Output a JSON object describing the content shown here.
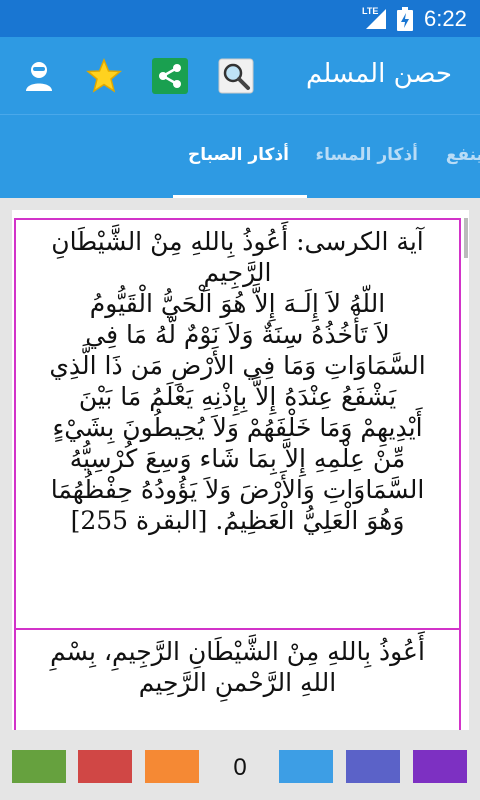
{
  "status_bar": {
    "network": "LTE",
    "time": "6:22",
    "icons": [
      "signal-icon",
      "battery-charging-icon"
    ]
  },
  "app_bar": {
    "title": "حصن المسلم",
    "icons": [
      "search-icon",
      "share-icon",
      "star-icon",
      "account-icon"
    ]
  },
  "tabs": [
    {
      "label": "أذكار الصباح",
      "active": true
    },
    {
      "label": "أذكار المساء",
      "active": false
    },
    {
      "label": "ينفع",
      "active": false
    }
  ],
  "cards": [
    {
      "lines": [
        "آية الكرسى: أَعُوذُ بِاللهِ مِنْ الشَّيْطَانِ",
        "الرَّجِيمِ",
        "اللّهُ لاَ إِلَـهَ إِلاَّ هُوَ الْحَيُّ الْقَيُّومُ",
        "لاَ تَأْخُذُهُ سِنَةٌ وَلاَ نَوْمٌ لَّهُ مَا فِي",
        "السَّمَاوَاتِ وَمَا فِي الأَرْضِ مَن ذَا الَّذِي",
        "يَشْفَعُ عِنْدَهُ إِلاَّ بِإِذْنِهِ يَعْلَمُ مَا بَيْنَ",
        "أَيْدِيهِمْ وَمَا خَلْفَهُمْ وَلاَ يُحِيطُونَ بِشَيْءٍ",
        "مِّنْ عِلْمِهِ إِلاَّ بِمَا شَاء وَسِعَ كُرْسِيُّهُ",
        "السَّمَاوَاتِ وَالأَرْضَ وَلاَ يَؤُودُهُ حِفْظُهُمَا",
        "وَهُوَ الْعَلِيُّ الْعَظِيمُ. [البقرة 255]"
      ]
    },
    {
      "lines": [
        "أَعُوذُ بِاللهِ مِنْ الشَّيْطَانِ الرَّجِيمِ، بِسْمِ",
        "اللهِ الرَّحْمنِ الرَّحِيم"
      ]
    }
  ],
  "bottom_bar": {
    "counter": "0",
    "swatch_colors": [
      "#66a13e",
      "#d04745",
      "#f58934",
      "#3d9ee5",
      "#5b62c8",
      "#7d30c2"
    ]
  }
}
